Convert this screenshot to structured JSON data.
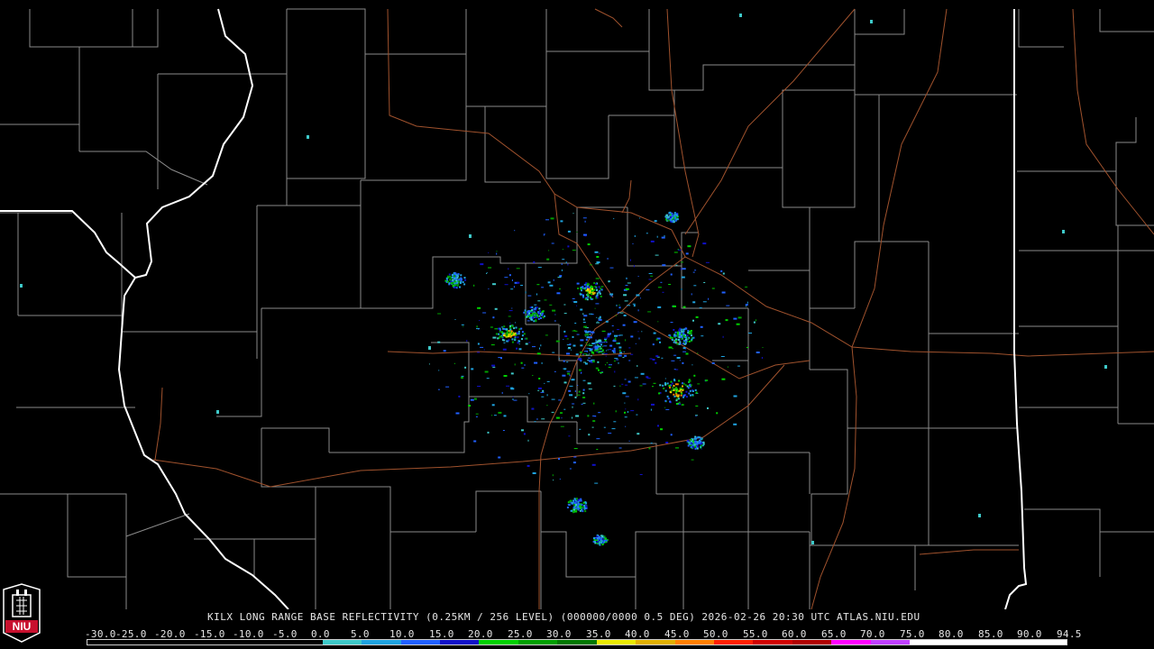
{
  "map": {
    "title": "KILX LONG RANGE BASE REFLECTIVITY (0.25KM / 256 LEVEL) (000000/0000 0.5 DEG) 2026-02-26 20:30 UTC  ATLAS.NIU.EDU",
    "radar_site": "KILX",
    "colors": {
      "background": "#000000",
      "county_lines": "#8a8a8a",
      "state_lines": "#ffffff",
      "highways": "#a0522d"
    }
  },
  "scale": {
    "labels": [
      "-30.0",
      "-25.0",
      "-20.0",
      "-15.0",
      "-10.0",
      "-5.0",
      "0.0",
      "5.0",
      "10.0",
      "15.0",
      "20.0",
      "25.0",
      "30.0",
      "35.0",
      "40.0",
      "45.0",
      "50.0",
      "55.0",
      "60.0",
      "65.0",
      "70.0",
      "75.0",
      "80.0",
      "85.0",
      "90.0",
      "94.5"
    ],
    "colors": [
      "#000000",
      "#000000",
      "#000000",
      "#000000",
      "#000000",
      "#000000",
      "#3ec9c9",
      "#1fa3e0",
      "#2060ff",
      "#1010c8",
      "#00d000",
      "#00a000",
      "#007800",
      "#e8e800",
      "#e0b000",
      "#ff8000",
      "#ff2000",
      "#d00000",
      "#b00000",
      "#ff00ff",
      "#c040ff",
      "#ffffff",
      "#ffffff",
      "#ffffff",
      "#ffffff"
    ]
  },
  "logo": {
    "text": "NIU",
    "colors": {
      "primary": "#c8102e",
      "secondary": "#ffffff"
    }
  }
}
